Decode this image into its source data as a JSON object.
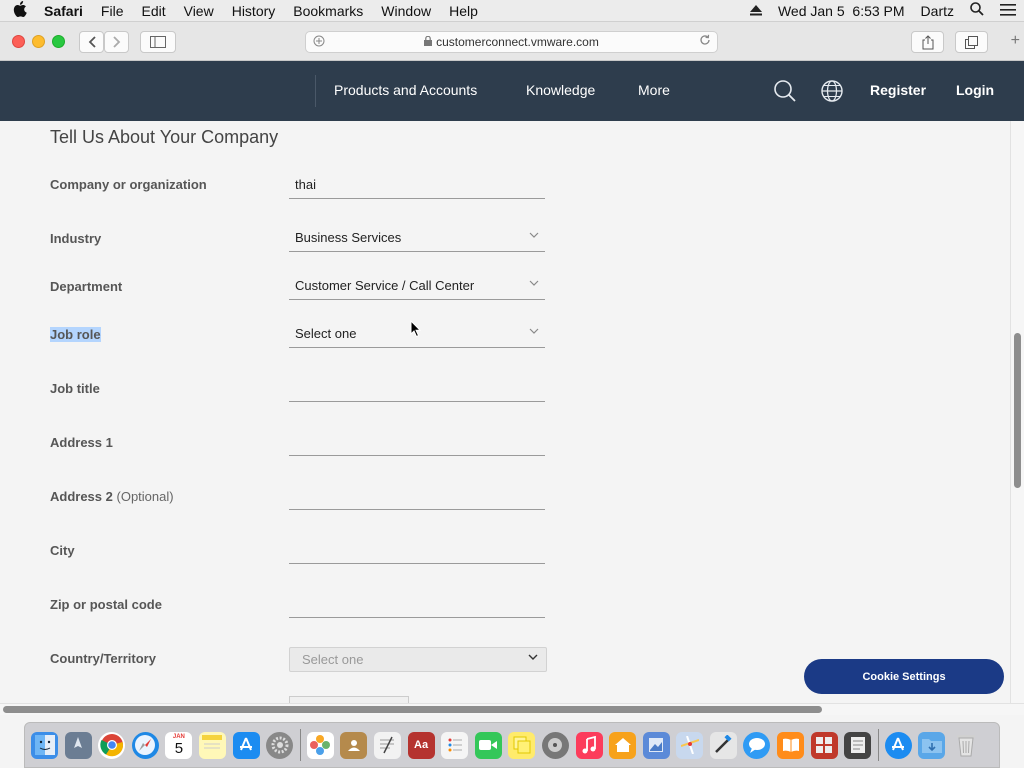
{
  "menubar": {
    "app_name": "Safari",
    "items": [
      "File",
      "Edit",
      "View",
      "History",
      "Bookmarks",
      "Window",
      "Help"
    ],
    "datetime": "Wed Jan 5  6:53 PM",
    "user": "Dartz"
  },
  "browser": {
    "url": "customerconnect.vmware.com"
  },
  "sitenav": {
    "links": [
      "Products and Accounts",
      "Knowledge",
      "More"
    ],
    "register": "Register",
    "login": "Login"
  },
  "form": {
    "section_title": "Tell Us About Your Company",
    "company": {
      "label": "Company or organization",
      "value": "thai"
    },
    "industry": {
      "label": "Industry",
      "value": "Business Services"
    },
    "department": {
      "label": "Department",
      "value": "Customer Service / Call Center"
    },
    "job_role": {
      "label": "Job role",
      "value": "Select one"
    },
    "job_title": {
      "label": "Job title",
      "value": ""
    },
    "address1": {
      "label": "Address 1",
      "value": ""
    },
    "address2": {
      "label": "Address 2",
      "optional": "(Optional)",
      "value": ""
    },
    "city": {
      "label": "City",
      "value": ""
    },
    "zip": {
      "label": "Zip or postal code",
      "value": ""
    },
    "country": {
      "label": "Country/Territory",
      "value": "Select one"
    }
  },
  "cookie_settings": "Cookie Settings",
  "dock": {
    "calendar_day": "5",
    "calendar_month": "JAN"
  }
}
